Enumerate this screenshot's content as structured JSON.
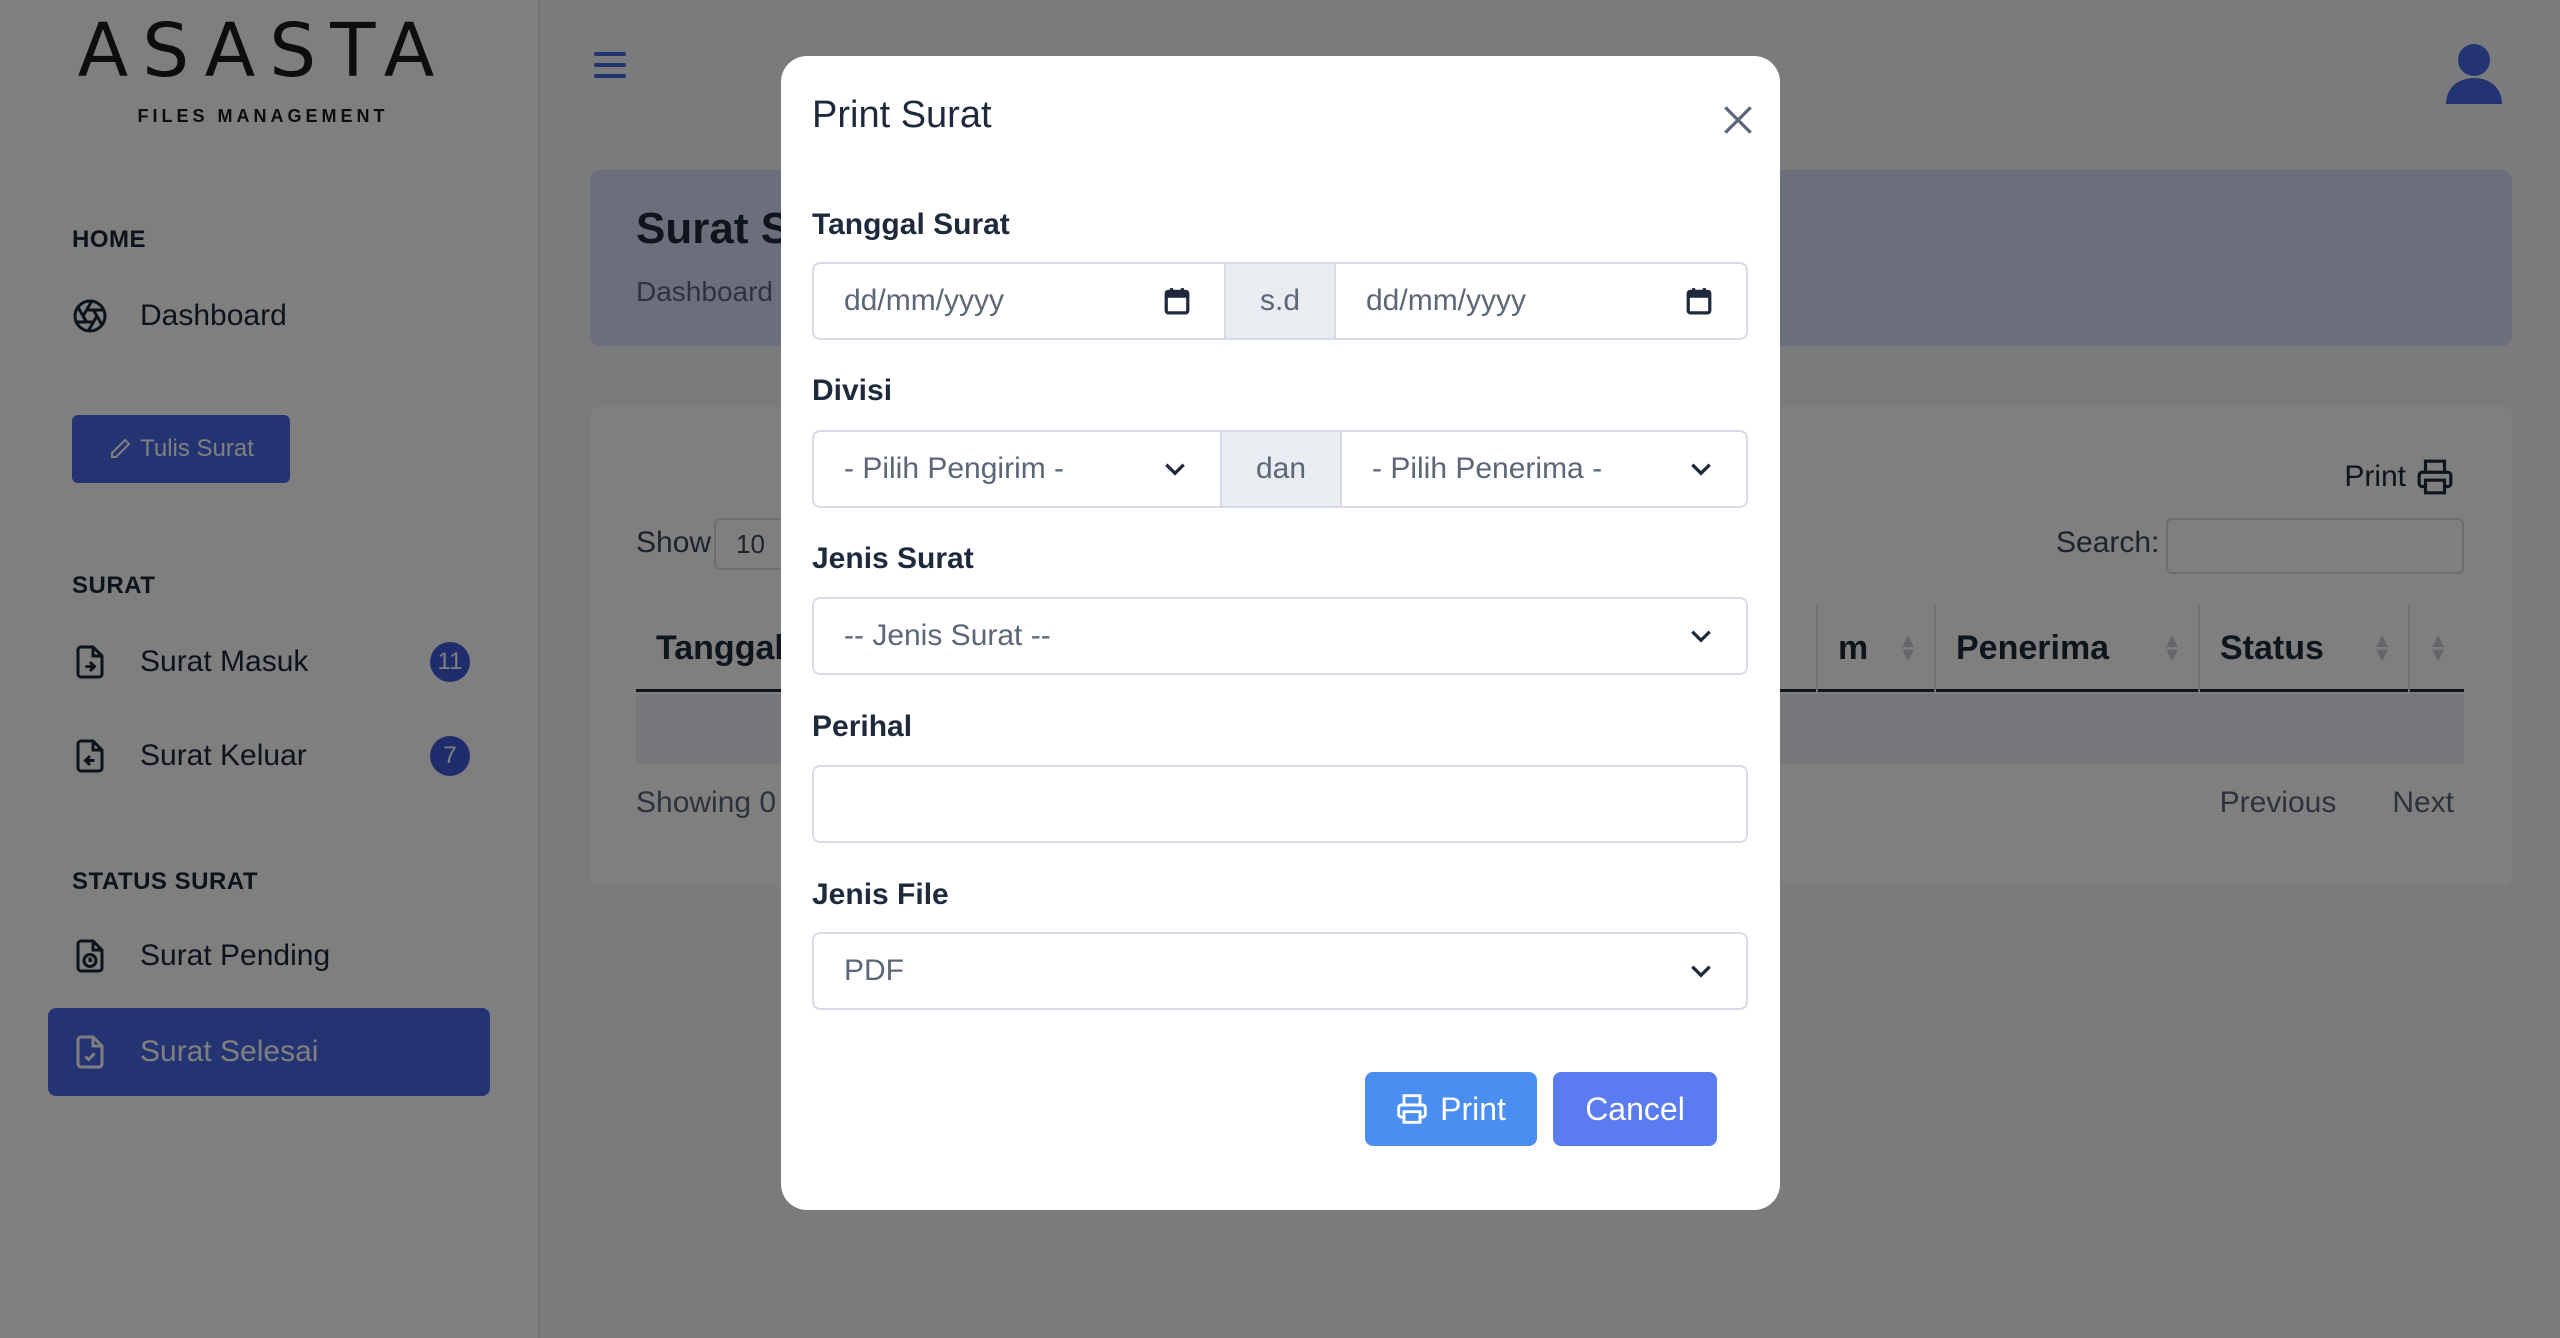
{
  "brand": {
    "logo_text": "ASASTA",
    "tagline": "FILES MANAGEMENT"
  },
  "sidebar": {
    "home_title": "HOME",
    "dashboard_label": "Dashboard",
    "write_button": "Tulis Surat",
    "surat_title": "SURAT",
    "surat_masuk_label": "Surat Masuk",
    "surat_masuk_count": "11",
    "surat_keluar_label": "Surat Keluar",
    "surat_keluar_count": "7",
    "status_title": "STATUS SURAT",
    "pending_label": "Surat Pending",
    "selesai_label": "Surat Selesai"
  },
  "page": {
    "title": "Surat S",
    "breadcrumb": "Dashboard",
    "print_label": "Print",
    "show_label": "Show",
    "show_value": "10",
    "search_label": "Search:",
    "columns": [
      "Tanggal",
      "",
      "m",
      "Penerima",
      "Status",
      ""
    ],
    "showing_text": "Showing 0",
    "previous_label": "Previous",
    "next_label": "Next"
  },
  "modal": {
    "title": "Print Surat",
    "tanggal_label": "Tanggal Surat",
    "date_from_placeholder": "dd/mm/yyyy",
    "date_sep": "s.d",
    "date_to_placeholder": "dd/mm/yyyy",
    "divisi_label": "Divisi",
    "pengirim_placeholder": "- Pilih Pengirim -",
    "divisi_sep": "dan",
    "penerima_placeholder": "- Pilih Penerima -",
    "jenis_surat_label": "Jenis Surat",
    "jenis_surat_placeholder": "-- Jenis Surat --",
    "perihal_label": "Perihal",
    "perihal_value": "",
    "jenis_file_label": "Jenis File",
    "jenis_file_value": "PDF",
    "print_button": "Print",
    "cancel_button": "Cancel"
  },
  "colors": {
    "accent": "#4969e6",
    "print_button": "#4b8ef1",
    "cancel_button": "#5a7cf0",
    "header_bg": "#d7def8"
  }
}
